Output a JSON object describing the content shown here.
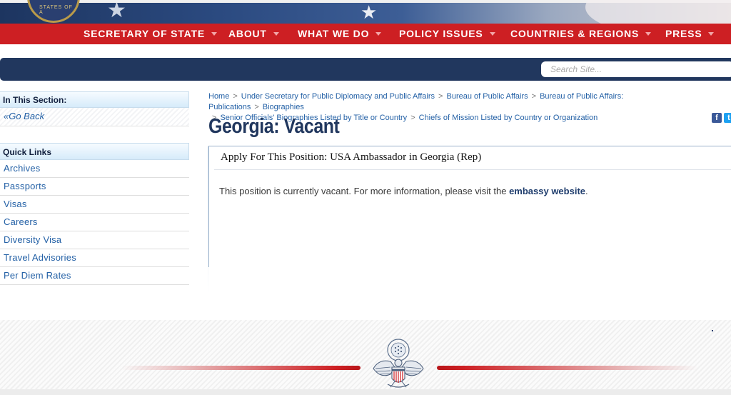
{
  "banner": {
    "seal_text": "STATES OF A"
  },
  "nav": {
    "items": [
      {
        "label": "SECRETARY OF STATE"
      },
      {
        "label": "ABOUT"
      },
      {
        "label": "WHAT WE DO"
      },
      {
        "label": "POLICY ISSUES"
      },
      {
        "label": "COUNTRIES & REGIONS"
      },
      {
        "label": "PRESS"
      }
    ]
  },
  "search": {
    "placeholder": "Search Site..."
  },
  "sidebar": {
    "section_title": "In This Section:",
    "go_back": "«Go Back",
    "quick_links_title": "Quick Links",
    "quick_links": [
      {
        "label": "Archives"
      },
      {
        "label": "Passports"
      },
      {
        "label": "Visas"
      },
      {
        "label": "Careers"
      },
      {
        "label": "Diversity Visa"
      },
      {
        "label": "Travel Advisories"
      },
      {
        "label": "Per Diem Rates"
      }
    ]
  },
  "breadcrumb": {
    "items": [
      {
        "label": "Home"
      },
      {
        "label": "Under Secretary for Public Diplomacy and Public Affairs"
      },
      {
        "label": "Bureau of Public Affairs"
      },
      {
        "label": "Bureau of Public Affairs: Publications"
      },
      {
        "label": "Biographies"
      },
      {
        "label": "Senior Officials' Biographies Listed by Title or Country"
      },
      {
        "label": "Chiefs of Mission Listed by Country or Organization"
      }
    ],
    "separator": ">"
  },
  "main": {
    "title": "Georgia: Vacant",
    "apply_title": "Apply For This Position: USA Ambassador in Georgia (Rep)",
    "vacant_text": "This position is currently vacant. For more information, please visit the ",
    "vacant_link": "embassy website",
    "vacant_end": "."
  },
  "share": {
    "facebook": "f",
    "twitter": "t"
  },
  "colors": {
    "nav_red": "#cd1f23",
    "navy": "#21375e",
    "link_blue": "#2461a6"
  }
}
